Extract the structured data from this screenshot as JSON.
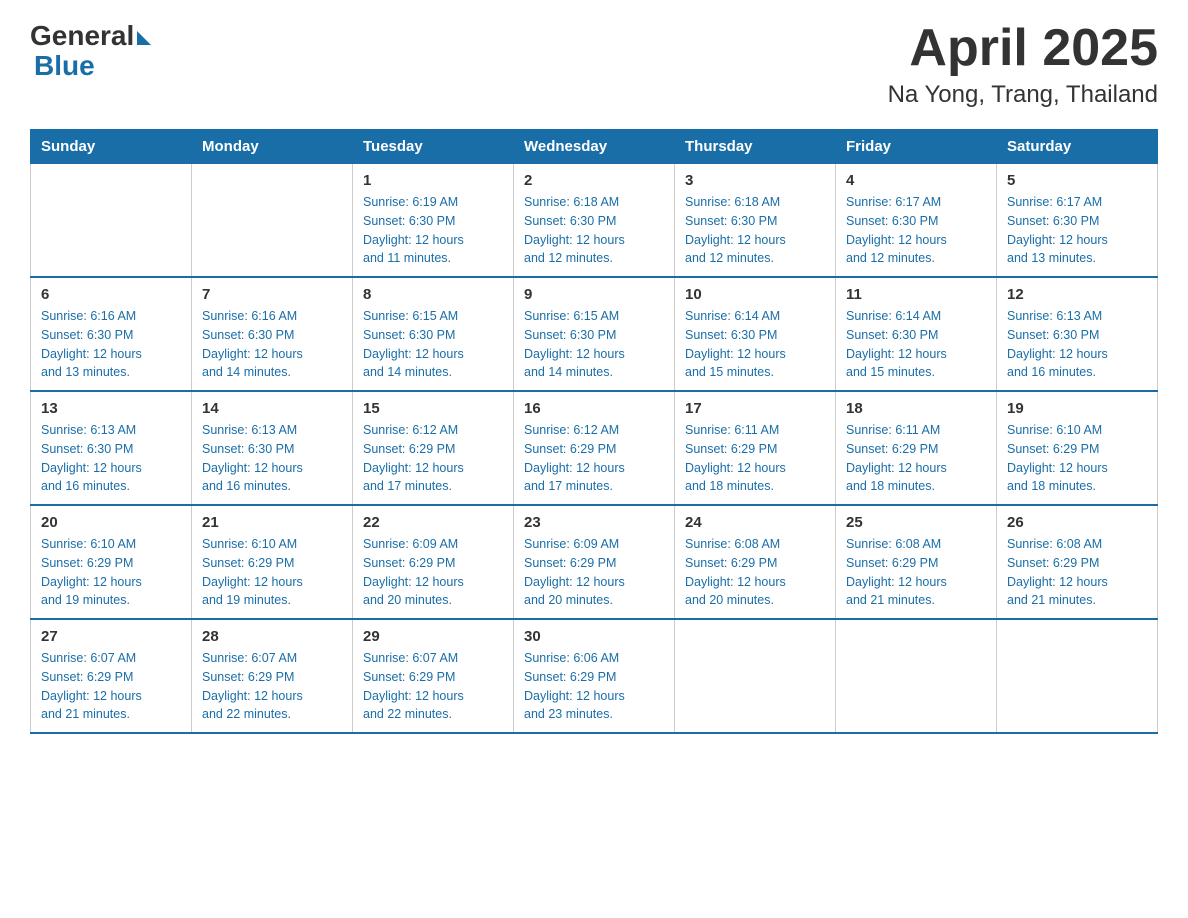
{
  "logo": {
    "general": "General",
    "blue": "Blue"
  },
  "title": "April 2025",
  "subtitle": "Na Yong, Trang, Thailand",
  "days_of_week": [
    "Sunday",
    "Monday",
    "Tuesday",
    "Wednesday",
    "Thursday",
    "Friday",
    "Saturday"
  ],
  "weeks": [
    [
      {
        "day": "",
        "info": ""
      },
      {
        "day": "",
        "info": ""
      },
      {
        "day": "1",
        "info": "Sunrise: 6:19 AM\nSunset: 6:30 PM\nDaylight: 12 hours\nand 11 minutes."
      },
      {
        "day": "2",
        "info": "Sunrise: 6:18 AM\nSunset: 6:30 PM\nDaylight: 12 hours\nand 12 minutes."
      },
      {
        "day": "3",
        "info": "Sunrise: 6:18 AM\nSunset: 6:30 PM\nDaylight: 12 hours\nand 12 minutes."
      },
      {
        "day": "4",
        "info": "Sunrise: 6:17 AM\nSunset: 6:30 PM\nDaylight: 12 hours\nand 12 minutes."
      },
      {
        "day": "5",
        "info": "Sunrise: 6:17 AM\nSunset: 6:30 PM\nDaylight: 12 hours\nand 13 minutes."
      }
    ],
    [
      {
        "day": "6",
        "info": "Sunrise: 6:16 AM\nSunset: 6:30 PM\nDaylight: 12 hours\nand 13 minutes."
      },
      {
        "day": "7",
        "info": "Sunrise: 6:16 AM\nSunset: 6:30 PM\nDaylight: 12 hours\nand 14 minutes."
      },
      {
        "day": "8",
        "info": "Sunrise: 6:15 AM\nSunset: 6:30 PM\nDaylight: 12 hours\nand 14 minutes."
      },
      {
        "day": "9",
        "info": "Sunrise: 6:15 AM\nSunset: 6:30 PM\nDaylight: 12 hours\nand 14 minutes."
      },
      {
        "day": "10",
        "info": "Sunrise: 6:14 AM\nSunset: 6:30 PM\nDaylight: 12 hours\nand 15 minutes."
      },
      {
        "day": "11",
        "info": "Sunrise: 6:14 AM\nSunset: 6:30 PM\nDaylight: 12 hours\nand 15 minutes."
      },
      {
        "day": "12",
        "info": "Sunrise: 6:13 AM\nSunset: 6:30 PM\nDaylight: 12 hours\nand 16 minutes."
      }
    ],
    [
      {
        "day": "13",
        "info": "Sunrise: 6:13 AM\nSunset: 6:30 PM\nDaylight: 12 hours\nand 16 minutes."
      },
      {
        "day": "14",
        "info": "Sunrise: 6:13 AM\nSunset: 6:30 PM\nDaylight: 12 hours\nand 16 minutes."
      },
      {
        "day": "15",
        "info": "Sunrise: 6:12 AM\nSunset: 6:29 PM\nDaylight: 12 hours\nand 17 minutes."
      },
      {
        "day": "16",
        "info": "Sunrise: 6:12 AM\nSunset: 6:29 PM\nDaylight: 12 hours\nand 17 minutes."
      },
      {
        "day": "17",
        "info": "Sunrise: 6:11 AM\nSunset: 6:29 PM\nDaylight: 12 hours\nand 18 minutes."
      },
      {
        "day": "18",
        "info": "Sunrise: 6:11 AM\nSunset: 6:29 PM\nDaylight: 12 hours\nand 18 minutes."
      },
      {
        "day": "19",
        "info": "Sunrise: 6:10 AM\nSunset: 6:29 PM\nDaylight: 12 hours\nand 18 minutes."
      }
    ],
    [
      {
        "day": "20",
        "info": "Sunrise: 6:10 AM\nSunset: 6:29 PM\nDaylight: 12 hours\nand 19 minutes."
      },
      {
        "day": "21",
        "info": "Sunrise: 6:10 AM\nSunset: 6:29 PM\nDaylight: 12 hours\nand 19 minutes."
      },
      {
        "day": "22",
        "info": "Sunrise: 6:09 AM\nSunset: 6:29 PM\nDaylight: 12 hours\nand 20 minutes."
      },
      {
        "day": "23",
        "info": "Sunrise: 6:09 AM\nSunset: 6:29 PM\nDaylight: 12 hours\nand 20 minutes."
      },
      {
        "day": "24",
        "info": "Sunrise: 6:08 AM\nSunset: 6:29 PM\nDaylight: 12 hours\nand 20 minutes."
      },
      {
        "day": "25",
        "info": "Sunrise: 6:08 AM\nSunset: 6:29 PM\nDaylight: 12 hours\nand 21 minutes."
      },
      {
        "day": "26",
        "info": "Sunrise: 6:08 AM\nSunset: 6:29 PM\nDaylight: 12 hours\nand 21 minutes."
      }
    ],
    [
      {
        "day": "27",
        "info": "Sunrise: 6:07 AM\nSunset: 6:29 PM\nDaylight: 12 hours\nand 21 minutes."
      },
      {
        "day": "28",
        "info": "Sunrise: 6:07 AM\nSunset: 6:29 PM\nDaylight: 12 hours\nand 22 minutes."
      },
      {
        "day": "29",
        "info": "Sunrise: 6:07 AM\nSunset: 6:29 PM\nDaylight: 12 hours\nand 22 minutes."
      },
      {
        "day": "30",
        "info": "Sunrise: 6:06 AM\nSunset: 6:29 PM\nDaylight: 12 hours\nand 23 minutes."
      },
      {
        "day": "",
        "info": ""
      },
      {
        "day": "",
        "info": ""
      },
      {
        "day": "",
        "info": ""
      }
    ]
  ]
}
